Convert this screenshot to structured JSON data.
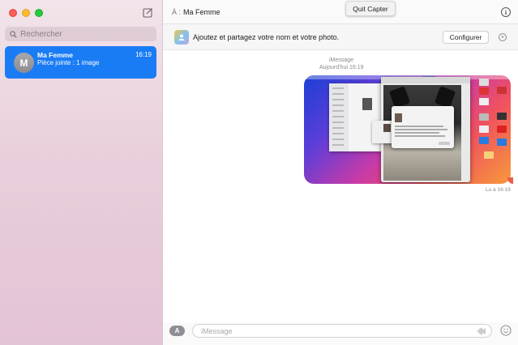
{
  "sidebar": {
    "search_placeholder": "Rechercher",
    "conversations": [
      {
        "initial": "M",
        "name": "Ma Femme",
        "time": "16:19",
        "preview": "Pièce jointe : 1 image"
      }
    ]
  },
  "header": {
    "to_label": "À :",
    "recipient": "Ma Femme",
    "quit_label": "Quit Capter"
  },
  "banner": {
    "text": "Ajoutez et partagez votre nom et votre photo.",
    "button_label": "Configurer",
    "close_glyph": "×"
  },
  "thread": {
    "service": "iMessage",
    "date": "Aujourd’hui 16:19",
    "read_status": "Lu à 16:19"
  },
  "composer": {
    "placeholder": "iMessage",
    "value": ""
  },
  "colors": {
    "accent": "#1a7cf5",
    "sidebar_top": "#f2e4ea",
    "sidebar_bottom": "#e3c3d6"
  },
  "icons": [
    "compose-icon",
    "search-icon",
    "info-icon",
    "contacts-icon",
    "close-icon",
    "app-store-icon",
    "audio-waveform-icon",
    "emoji-icon"
  ]
}
